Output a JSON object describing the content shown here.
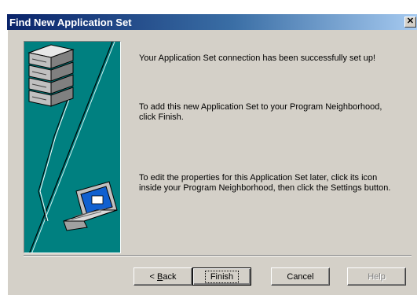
{
  "window": {
    "title": "Find New Application Set",
    "close_glyph": "✕"
  },
  "messages": {
    "line1": "Your Application Set connection has been successfully set up!",
    "line2": "To add this new Application Set to your Program Neighborhood, click Finish.",
    "line3": "To edit the properties for this Application Set later, click its icon inside your Program Neighborhood, then click the Settings button."
  },
  "buttons": {
    "back_mnemonic": "B",
    "back_rest": "ack",
    "back_prefix": "< ",
    "finish": "Finish",
    "cancel": "Cancel",
    "help": "Help"
  },
  "colors": {
    "illustration_bg": "#008080",
    "titlebar_start": "#0a246a",
    "dialog_bg": "#d4d0c8"
  },
  "icons": [
    "server-icon",
    "laptop-icon",
    "connection-line-icon",
    "close-icon"
  ]
}
